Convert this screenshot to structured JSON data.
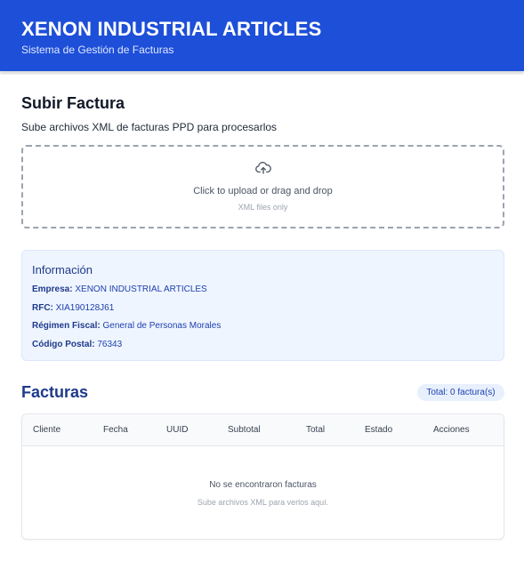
{
  "header": {
    "title": "XENON INDUSTRIAL ARTICLES",
    "subtitle": "Sistema de Gestión de Facturas",
    "color": "#1d4fd8"
  },
  "upload": {
    "title": "Subir Factura",
    "description": "Sube archivos XML de facturas PPD para procesarlos",
    "dropzone_label": "Click to upload or drag and drop",
    "dropzone_hint": "XML files only",
    "icon": "cloud-upload-icon"
  },
  "info": {
    "title": "Información",
    "rows": [
      {
        "label": "Empresa:",
        "value": "XENON INDUSTRIAL ARTICLES"
      },
      {
        "label": "RFC:",
        "value": "XIA190128J61"
      },
      {
        "label": "Régimen Fiscal:",
        "value": "General de Personas Morales"
      },
      {
        "label": "Código Postal:",
        "value": "76343"
      }
    ]
  },
  "facturas": {
    "title": "Facturas",
    "total_badge": "Total: 0 factura(s)",
    "columns": [
      "Cliente",
      "Fecha",
      "UUID",
      "Subtotal",
      "Total",
      "Estado",
      "Acciones"
    ],
    "empty_title": "No se encontraron facturas",
    "empty_subtitle": "Sube archivos XML para verlos aquí."
  }
}
